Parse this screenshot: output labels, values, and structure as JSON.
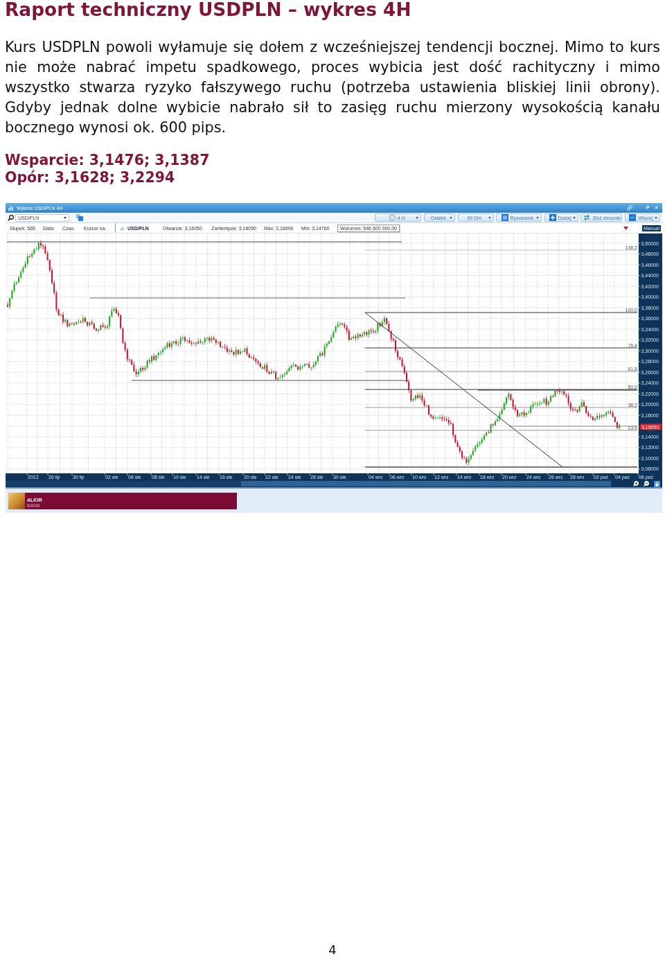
{
  "title": "Raport techniczny USDPLN – wykres 4H",
  "paragraph": "Kurs USDPLN powoli wyłamuje się dołem z wcześniejszej tendencji bocznej. Mimo to kurs nie może nabrać impetu spadkowego, proces wybicia jest dość rachityczny i mimo wszystko stwarza ryzyko fałszywego ruchu (potrzeba ustawienia bliskiej linii obrony). Gdyby jednak dolne wybicie nabrało sił to zasięg ruchu mierzony wysokością kanału bocznego wynosi ok. 600 pips.",
  "levels": [
    "Wsparcie: 3,1476; 3,1387",
    "Opór: 3,1628; 3,2294"
  ],
  "chart_window": {
    "title": "Wykres USD/PLN 4H",
    "window_buttons": [
      "P",
      "×"
    ],
    "instrument_field": {
      "value": "USD/PLN"
    },
    "toolbar_buttons": [
      {
        "label": "4 H",
        "kind": "dropdown"
      },
      {
        "label": "Ostatni",
        "kind": "dropdown"
      },
      {
        "label": "90 Dni",
        "kind": "dropdown"
      },
      {
        "label": "Rysowanie",
        "kind": "dropdown"
      },
      {
        "label": "Dodaj",
        "kind": "dropdown"
      },
      {
        "label": "Złóż zlecenie",
        "kind": "button"
      },
      {
        "label": "Więcej",
        "kind": "dropdown"
      }
    ],
    "info_bar": [
      {
        "text": "Słupek: 565",
        "kind": "plain"
      },
      {
        "text": "Data:",
        "kind": "plain"
      },
      {
        "text": "Czas:",
        "kind": "plain"
      },
      {
        "text": "Kursor na:",
        "kind": "plain"
      },
      {
        "text": "USD/PLN",
        "kind": "instrument"
      },
      {
        "text": "Otwarcie: 3,16050",
        "kind": "plain"
      },
      {
        "text": "Zamknięcie: 3,16050",
        "kind": "plain"
      },
      {
        "text": "Max: 3,16690",
        "kind": "plain"
      },
      {
        "text": "Min: 3,14760",
        "kind": "plain"
      },
      {
        "text": "Wolumen: 546 600 000,00",
        "kind": "boxed"
      }
    ],
    "mode_label": "Manual",
    "price_axis": [
      "3,50000",
      "3,48000",
      "3,46000",
      "3,44000",
      "3,42000",
      "3,40000",
      "3,38000",
      "3,36000",
      "3,34000",
      "3,32000",
      "3,30000",
      "3,28000",
      "3,26000",
      "3,24000",
      "3,22000",
      "3,20000",
      "3,18000",
      "3,14000",
      "3,12000",
      "3,10000",
      "3,08000"
    ],
    "current_price": "3,16050",
    "fibonacci_levels": [
      "138,2",
      "100,0",
      "76,4",
      "61,8",
      "50,0",
      "38,2",
      "23,6"
    ],
    "time_axis": [
      "2012",
      "26 lip",
      "30 lip",
      "02 sie",
      "06 sie",
      "08 sie",
      "10 sie",
      "14 sie",
      "16 sie",
      "20 sie",
      "22 sie",
      "24 sie",
      "28 sie",
      "30 sie",
      "04 wrz",
      "06 wrz",
      "10 wrz",
      "12 wrz",
      "14 wrz",
      "18 wrz",
      "20 wrz",
      "24 wrz",
      "26 wrz",
      "28 wrz",
      "02 paź",
      "04 paź",
      "06 paź"
    ]
  },
  "banner": {
    "name": "ALIOR",
    "subtitle": "BANK"
  },
  "page_number": "4"
}
